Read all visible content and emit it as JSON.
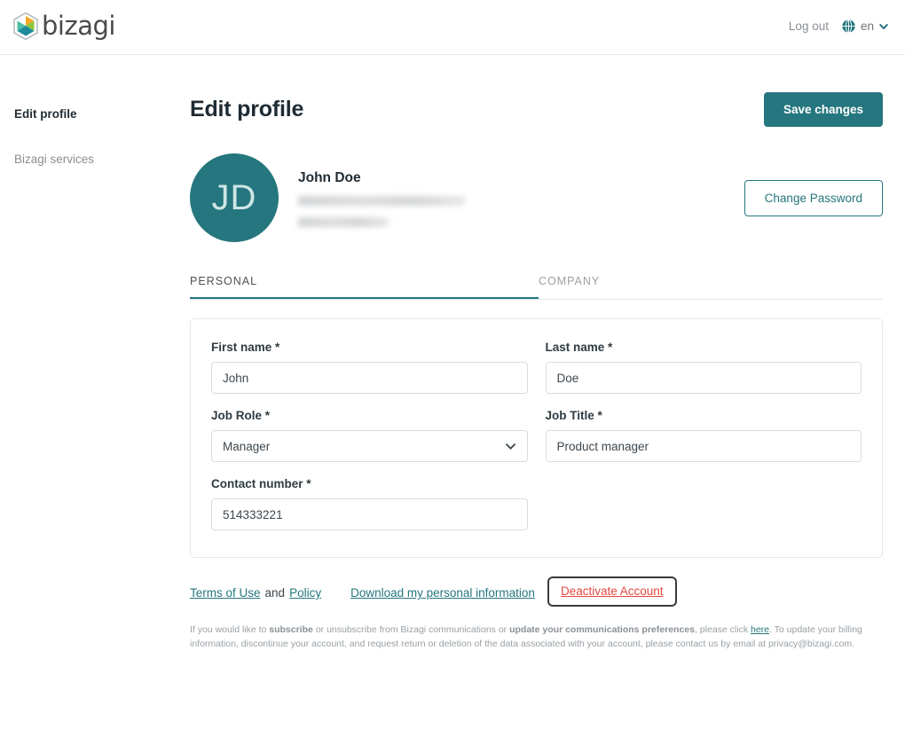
{
  "topbar": {
    "logo_text": "bizagi",
    "logo_icon": "bizagi-hexagon-logo",
    "logout_label": "Log out",
    "globe_icon": "globe-icon",
    "language_code": "en",
    "chevron_icon": "chevron-down-icon",
    "accent_color": "#25767e"
  },
  "sidebar": {
    "items": [
      {
        "label": "Edit profile",
        "active": true
      },
      {
        "label": "Bizagi services",
        "active": false
      }
    ]
  },
  "header": {
    "title": "Edit profile",
    "save_label": "Save changes"
  },
  "user": {
    "initials": "JD",
    "name": "John Doe",
    "email_redacted": "",
    "org_redacted": "",
    "change_password_label": "Change Password"
  },
  "tabs": [
    {
      "label": "PERSONAL",
      "active": true
    },
    {
      "label": "COMPANY",
      "active": false
    }
  ],
  "form": {
    "fields": [
      {
        "label": "First name *",
        "value": "John",
        "type": "text"
      },
      {
        "label": "Last name *",
        "value": "Doe",
        "type": "text"
      },
      {
        "label": "Job Role *",
        "value": "Manager",
        "type": "select"
      },
      {
        "label": "Job Title *",
        "value": "Product manager",
        "type": "text"
      },
      {
        "label": "Contact number *",
        "value": "514333221",
        "type": "text"
      }
    ]
  },
  "footer": {
    "terms_label": "Terms of Use",
    "and_label": "and",
    "policy_label": "Policy",
    "download_label": "Download my personal information",
    "deactivate_label": "Deactivate Account",
    "deactivate_color": "#e2493f",
    "fineprint": {
      "p1": "If you would like to ",
      "b1": "subscribe",
      "p2": " or unsubscribe from Bizagi communications or ",
      "b2": "update your communications preferences",
      "p3": ", please click ",
      "link": "here",
      "p4": ". To update your billing information, discontinue your account, and request return or deletion of the data associated with your account, please contact us by email at privacy@bizagi.com."
    }
  }
}
